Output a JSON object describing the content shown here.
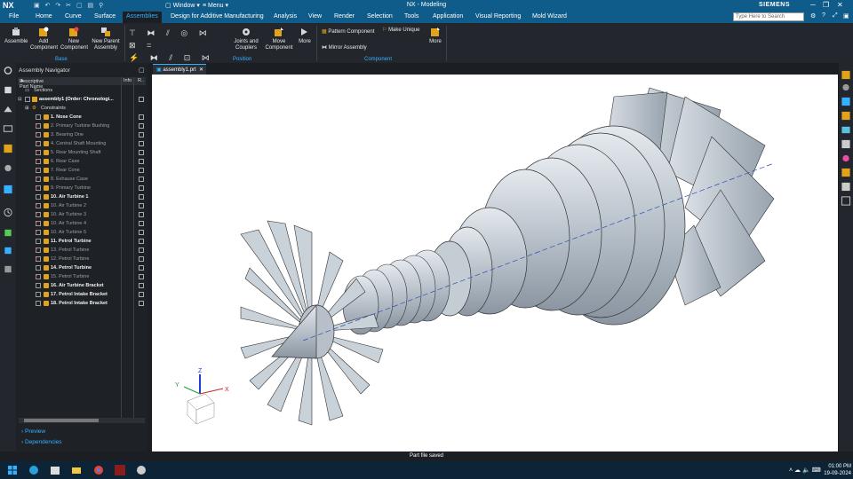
{
  "app": {
    "logo": "NX",
    "title": "NX - Modeling",
    "brand": "SIEMENS",
    "window_menu": "Window",
    "menu_menu": "Menu",
    "search_placeholder": "Type Here to Search"
  },
  "menubar": {
    "tabs": [
      "File",
      "Home",
      "Curve",
      "Surface",
      "Assemblies",
      "Design for Additive Manufacturing",
      "Analysis",
      "View",
      "Render",
      "Selection",
      "Tools",
      "Application",
      "Visual Reporting",
      "Mold Wizard"
    ],
    "active": "Assemblies"
  },
  "ribbon": {
    "assemble": "Assemble",
    "add_component": "Add Component",
    "new_component": "New Component",
    "new_parent": "New Parent Assembly",
    "group_base": "Base",
    "joints": "Joints and Couplers",
    "move_component": "Move Component",
    "more1": "More",
    "group_position": "Position",
    "pattern_component": "Pattern Component",
    "make_unique": "Make Unique",
    "mirror_assembly": "Mirror Assembly",
    "more2": "More",
    "group_component": "Component"
  },
  "navigator": {
    "title": "Assembly Navigator",
    "col_name": "Descriptive Part Name",
    "col_info": "Info",
    "col_r": "R..",
    "sections": "Sections",
    "root": "assembly1 (Order: Chronologi...",
    "constraints": "Constraints",
    "items": [
      {
        "label": "1. Nose Cone",
        "state": "bold",
        "mark": ""
      },
      {
        "label": "2. Primary Turbine Bushing",
        "state": "dim",
        "mark": "✓"
      },
      {
        "label": "3. Bearing One",
        "state": "dim",
        "mark": "✓"
      },
      {
        "label": "4. Central Shaft Mounting",
        "state": "dim",
        "mark": "✓"
      },
      {
        "label": "5. Rear Mounting Shaft",
        "state": "dim",
        "mark": "✓"
      },
      {
        "label": "6. Rear Case",
        "state": "dim",
        "mark": "✓"
      },
      {
        "label": "7. Rear Cone",
        "state": "dim",
        "mark": "✓"
      },
      {
        "label": "8. Exhause Case",
        "state": "dim",
        "mark": "✓"
      },
      {
        "label": "9. Primary Turbine",
        "state": "dim",
        "mark": "✓"
      },
      {
        "label": "10. Air Turbine 1",
        "state": "bold",
        "mark": ""
      },
      {
        "label": "10. Air Turbine 2",
        "state": "dim",
        "mark": "✓"
      },
      {
        "label": "10. Air Turbine 3",
        "state": "dim",
        "mark": "✓"
      },
      {
        "label": "10. Air Turbine 4",
        "state": "dim",
        "mark": "✓"
      },
      {
        "label": "10. Air Turbine 5",
        "state": "dim",
        "mark": "✓"
      },
      {
        "label": "11. Petrol Turbine",
        "state": "bold",
        "mark": ""
      },
      {
        "label": "13. Petrol Turbine",
        "state": "dim",
        "mark": "✓"
      },
      {
        "label": "12. Petrol Turbine",
        "state": "dim",
        "mark": "✓"
      },
      {
        "label": "14. Petrol Turbine",
        "state": "bold",
        "mark": ""
      },
      {
        "label": "15. Petrol Turbine",
        "state": "dim",
        "mark": "✓"
      },
      {
        "label": "16. Air Turbine Bracket",
        "state": "bold",
        "mark": ""
      },
      {
        "label": "17. Petrol Intake Bracket",
        "state": "bold",
        "mark": ""
      },
      {
        "label": "18. Petrol Intake Bracket",
        "state": "bold",
        "mark": ""
      }
    ],
    "preview": "Preview",
    "dependencies": "Dependencies"
  },
  "document": {
    "tab_label": "assembly1.prt"
  },
  "triad": {
    "x": "X",
    "y": "Y",
    "z": "Z"
  },
  "status": "Part file saved",
  "taskbar": {
    "time": "01:00 PM",
    "date": "19-09-2024"
  },
  "colors": {
    "title_blue": "#0f5c8a",
    "accent": "#36b1ff",
    "check_red": "#e33333",
    "component_orange": "#e2a31b",
    "model_gray": "#bfc7cf"
  }
}
